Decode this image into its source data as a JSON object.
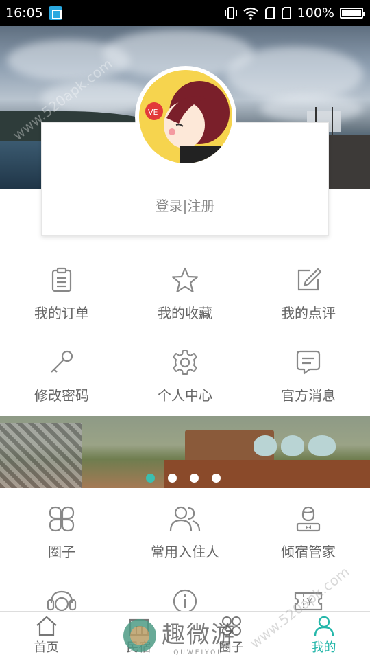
{
  "status_bar": {
    "time": "16:05",
    "battery": "100%",
    "battery_level": 1.0
  },
  "profile": {
    "login_label": "登录|注册"
  },
  "menu_top": [
    {
      "label": "我的订单",
      "icon": "clipboard-icon"
    },
    {
      "label": "我的收藏",
      "icon": "star-icon"
    },
    {
      "label": "我的点评",
      "icon": "edit-icon"
    },
    {
      "label": "修改密码",
      "icon": "key-icon"
    },
    {
      "label": "个人中心",
      "icon": "gear-icon"
    },
    {
      "label": "官方消息",
      "icon": "message-icon"
    }
  ],
  "banner": {
    "slide_count": 4,
    "active_slide": 1
  },
  "menu_bottom": [
    {
      "label": "圈子",
      "icon": "circles-icon"
    },
    {
      "label": "常用入住人",
      "icon": "users-icon"
    },
    {
      "label": "倾宿管家",
      "icon": "butler-icon"
    },
    {
      "label": "",
      "icon": "headset-icon"
    },
    {
      "label": "",
      "icon": "info-icon"
    },
    {
      "label": "",
      "icon": "coupon-icon"
    }
  ],
  "bottom_nav": [
    {
      "label": "首页",
      "icon": "home-icon"
    },
    {
      "label": "民宿",
      "icon": "house-icon"
    },
    {
      "label": "圈子",
      "icon": "circles-icon"
    },
    {
      "label": "我的",
      "icon": "person-icon",
      "active": true
    }
  ],
  "brand": {
    "name": "趣微游",
    "pinyin": "QUWEIYOU"
  },
  "watermark": {
    "top": "www.520apk.com",
    "bottom": "www.520apk.com"
  },
  "colors": {
    "accent": "#25b7aa",
    "dot_active": "#3bbfb0",
    "icon_gray": "#888888"
  }
}
